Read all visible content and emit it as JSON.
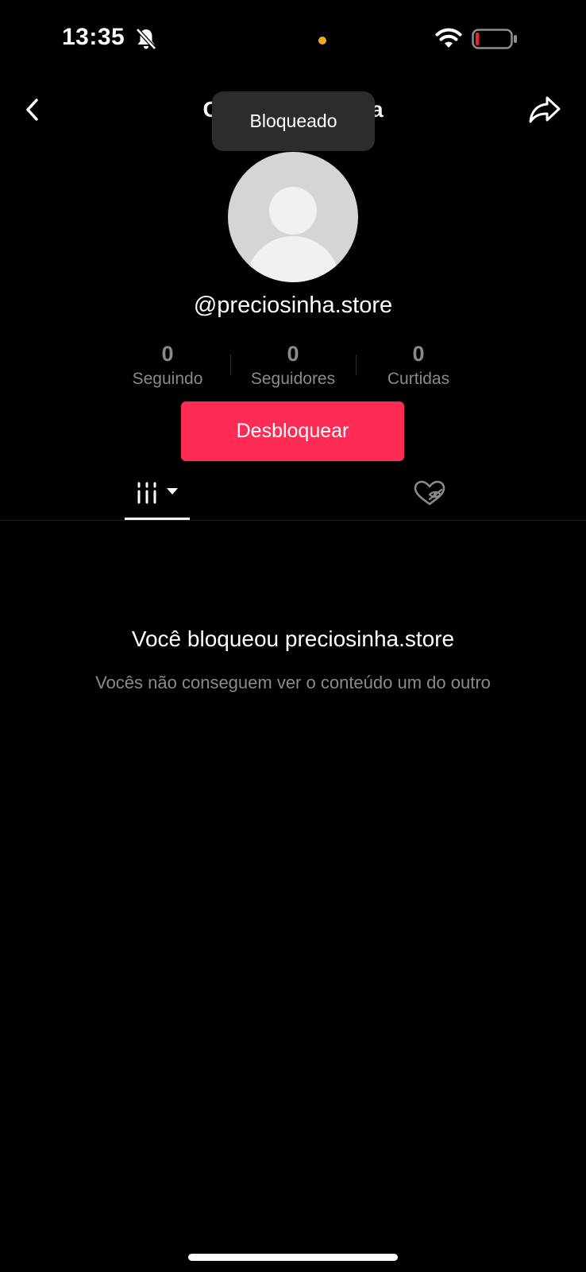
{
  "status_bar": {
    "time": "13:35",
    "icons": [
      "bell-slash-icon",
      "camera-indicator-dot",
      "wifi-icon",
      "battery-low-icon"
    ],
    "indicator_color": "#f5a623",
    "battery_color": "#e0262f"
  },
  "header": {
    "title": "Conta bloqueada",
    "back_icon": "chevron-left-icon",
    "share_icon": "share-arrow-icon"
  },
  "toast": {
    "text": "Bloqueado"
  },
  "profile": {
    "username": "@preciosinha.store",
    "avatar": "default-avatar-icon"
  },
  "stats": [
    {
      "value": "0",
      "label": "Seguindo"
    },
    {
      "value": "0",
      "label": "Seguidores"
    },
    {
      "value": "0",
      "label": "Curtidas"
    }
  ],
  "actions": {
    "unblock_label": "Desbloquear",
    "accent": "#fe2c55"
  },
  "tabs": [
    {
      "name": "videos",
      "icon": "grid-filter-icon",
      "active": true
    },
    {
      "name": "liked",
      "icon": "heart-hidden-icon",
      "active": false
    }
  ],
  "empty_state": {
    "title": "Você bloqueou preciosinha.store",
    "subtitle": "Vocês não conseguem ver o conteúdo um do outro"
  }
}
